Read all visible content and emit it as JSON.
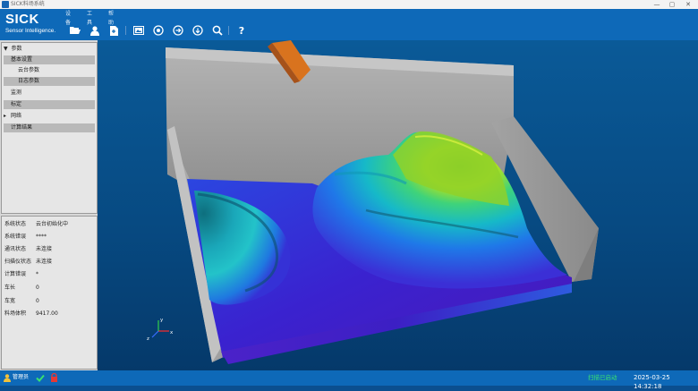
{
  "window": {
    "title": "SICK料场系统",
    "controls": [
      "—",
      "▢",
      "✕"
    ]
  },
  "header": {
    "brand": "SICK",
    "tagline": "Sensor Intelligence.",
    "menu": [
      "设备",
      "工具",
      "帮助"
    ]
  },
  "toolbar": {
    "icons": [
      "folder-open-icon",
      "user-icon",
      "export-icon",
      "image-view-icon",
      "target-icon",
      "arrow-right-circle-icon",
      "arrow-down-circle-icon",
      "zoom-icon",
      "help-icon"
    ],
    "help_label": "?"
  },
  "tree": {
    "items": [
      {
        "label": "参数",
        "prefix": "▼"
      },
      {
        "label": "基本设置"
      },
      {
        "label": "云台参数"
      },
      {
        "label": "日志参数"
      },
      {
        "label": "监测"
      },
      {
        "label": "标定"
      },
      {
        "label": "网络",
        "prefix": "▸"
      },
      {
        "label": "计算结果"
      }
    ]
  },
  "status_info": {
    "rows": [
      {
        "label": "系统状态",
        "value": "云台初始化中"
      },
      {
        "label": "系统错误",
        "value": "****"
      },
      {
        "label": "通讯状态",
        "value": "未连接"
      },
      {
        "label": "扫描仪状态",
        "value": "未连接"
      },
      {
        "label": "计算错误",
        "value": "*"
      },
      {
        "label": "车长",
        "value": "0"
      },
      {
        "label": "车宽",
        "value": "0"
      },
      {
        "label": "料场体积",
        "value": "9417.00"
      }
    ]
  },
  "viewport": {
    "axis_labels": {
      "x": "x",
      "y": "y",
      "z": "z"
    },
    "colors": {
      "background": "#0a5a98",
      "wall": "#a8a8a8",
      "floor": "#3a16c4",
      "peak": "#8fd12a",
      "beam": "#d9731e"
    }
  },
  "statusbar": {
    "user": "管理员",
    "scan_status": "扫描已启动",
    "datetime": "2025-03-25 14:32:18",
    "colors": {
      "ok": "#39e070",
      "alert": "#e53935"
    }
  }
}
